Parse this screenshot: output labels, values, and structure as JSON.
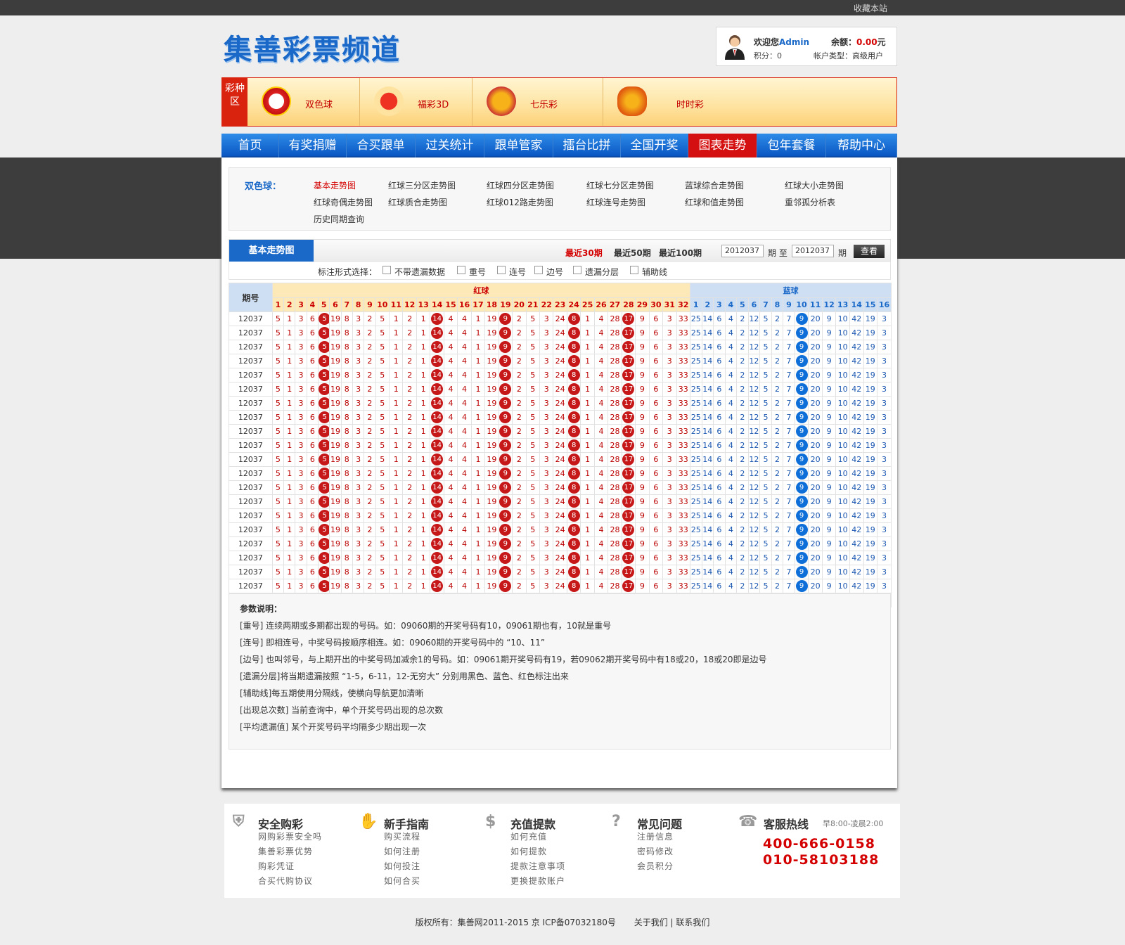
{
  "topbar": {
    "favorite": "收藏本站"
  },
  "logo": "集善彩票频道",
  "user": {
    "welcome": "欢迎您",
    "name": "Admin",
    "balance_label": "余额：",
    "balance": "0.00",
    "unit": "元",
    "points": "积分：0",
    "type": "帐户类型：高级用户"
  },
  "lottery_zone": "彩种区",
  "lotteries": [
    "双色球",
    "福彩3D",
    "七乐彩",
    "时时彩"
  ],
  "nav": [
    "首页",
    "有奖捐赠",
    "合买跟单",
    "过关统计",
    "跟单管家",
    "擂台比拼",
    "全国开奖",
    "图表走势",
    "包年套餐",
    "帮助中心"
  ],
  "sub": {
    "title": "双色球：",
    "links": [
      "基本走势图",
      "红球三分区走势图",
      "红球四分区走势图",
      "红球七分区走势图",
      "蓝球综合走势图",
      "红球大小走势图",
      "红球奇偶走势图",
      "红球质合走势图",
      "红球012路走势图",
      "红球连号走势图",
      "红球和值走势图",
      "重邻孤分析表",
      "历史同期查询"
    ]
  },
  "chart_header": {
    "tab": "基本走势图",
    "recent30": "最近30期",
    "recent50": "最近50期",
    "recent100": "最近100期",
    "from": "2012037",
    "period1": "期 至",
    "to": "2012037",
    "period2": "期",
    "query": "查看"
  },
  "options": {
    "label": "标注形式选择：",
    "items": [
      "不带遗漏数据",
      "重号",
      "连号",
      "边号",
      "遗漏分层",
      "辅助线"
    ]
  },
  "table": {
    "issue_header": "期号",
    "red_header": "红球",
    "blue_header": "蓝球",
    "issue": "12037",
    "red_values": [
      "5",
      "1",
      "3",
      "6",
      "5",
      "19",
      "8",
      "3",
      "2",
      "5",
      "1",
      "2",
      "1",
      "14",
      "4",
      "4",
      "1",
      "19",
      "9",
      "2",
      "5",
      "3",
      "24",
      "8",
      "1",
      "4",
      "28",
      "17",
      "9",
      "6",
      "3",
      "33"
    ],
    "red_hits": [
      5,
      14,
      19,
      24,
      28,
      33
    ],
    "blue_values": [
      "25",
      "14",
      "6",
      "4",
      "2",
      "12",
      "5",
      "2",
      "7",
      "9",
      "20",
      "9",
      "10",
      "42",
      "19",
      "3"
    ],
    "blue_hit": 10,
    "rows": 21
  },
  "notes": {
    "title": "参数说明：",
    "lines": [
      "[重号] 连续两期或多期都出现的号码。如：09060期的开奖号码有10，09061期也有，10就是重号",
      "[连号] 即相连号，中奖号码按顺序相连。如：09060期的开奖号码中的 “10、11”",
      "[边号] 也叫邻号，与上期开出的中奖号码加减余1的号码。如：09061期开奖号码有19，若09062期开奖号码中有18或20，18或20即是边号",
      "[遗漏分层]将当期遗漏按照 “1-5，6-11，12-无穷大” 分别用黑色、蓝色、红色标注出来",
      "[辅助线]每五期使用分隔线，使横向导航更加清晰",
      "[出现总次数] 当前查询中，单个开奖号码出现的总次数",
      "[平均遗漏值] 某个开奖号码平均隔多少期出现一次"
    ]
  },
  "footer": {
    "cols": [
      {
        "title": "安全购彩",
        "links": [
          "网购彩票安全吗",
          "集善彩票优势",
          "购彩凭证",
          "合买代购协议"
        ]
      },
      {
        "title": "新手指南",
        "links": [
          "购买流程",
          "如何注册",
          "如何投注",
          "如何合买"
        ]
      },
      {
        "title": "充值提款",
        "links": [
          "如何充值",
          "如何提款",
          "提款注意事项",
          "更换提款账户"
        ]
      },
      {
        "title": "常见问题",
        "links": [
          "注册信息",
          "密码修改",
          "会员积分"
        ]
      }
    ],
    "hotline": {
      "title": "客服热线",
      "hours": "早8:00-凌晨2:00",
      "phone1": "400-666-0158",
      "phone2": "010-58103188"
    }
  },
  "copyright": {
    "text": "版权所有：集善网2011-2015   京 ICP备07032180号",
    "about": "关于我们",
    "sep": "|",
    "contact": "联系我们"
  }
}
